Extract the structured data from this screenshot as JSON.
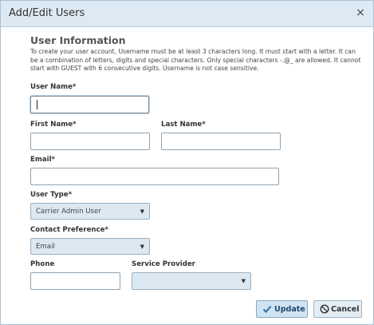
{
  "dialog": {
    "title": "Add/Edit Users",
    "close_icon": "×"
  },
  "section": {
    "title": "User Information",
    "description": "To create your user account, Username must be at least 3 characters long. It must start with a letter. It can be a combination of letters, digits and special characters. Only special characters -.@_ are allowed. It cannot start with GUEST with 6 consecutive digits. Username is not case sensitive."
  },
  "fields": {
    "username": {
      "label": "User Name*",
      "value": ""
    },
    "first_name": {
      "label": "First Name*",
      "value": ""
    },
    "last_name": {
      "label": "Last Name*",
      "value": ""
    },
    "email": {
      "label": "Email*",
      "value": ""
    },
    "user_type": {
      "label": "User Type*",
      "selected": "Carrier Admin User"
    },
    "contact_preference": {
      "label": "Contact Preference*",
      "selected": "Email"
    },
    "phone": {
      "label": "Phone",
      "value": ""
    },
    "service_provider": {
      "label": "Service Provider",
      "selected": ""
    }
  },
  "buttons": {
    "update": {
      "label": "Update",
      "icon": "check-icon"
    },
    "cancel": {
      "label": "Cancel",
      "icon": "no-entry-icon"
    }
  }
}
